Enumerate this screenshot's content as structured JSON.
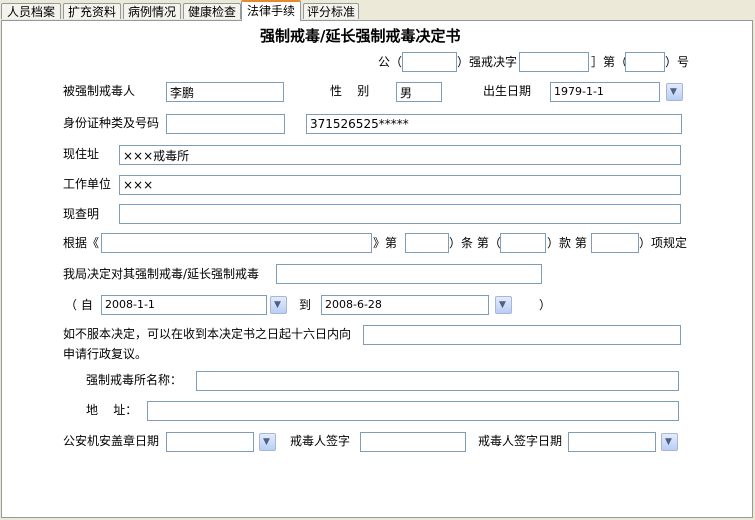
{
  "tabs": [
    {
      "label": "人员档案"
    },
    {
      "label": "扩充资料"
    },
    {
      "label": "病例情况"
    },
    {
      "label": "健康检查"
    },
    {
      "label": "法律手续"
    },
    {
      "label": "评分标准"
    }
  ],
  "form": {
    "title": "强制戒毒/延长强制戒毒决定书",
    "doc_no": {
      "prefix": "公（",
      "mid": "）强戒决字［",
      "mid2": "］第（",
      "suffix": "）号",
      "v1": "",
      "v2": "",
      "v3": ""
    },
    "person": {
      "label": "被强制戒毒人",
      "value": "李鹏"
    },
    "gender": {
      "label": "性    别",
      "value": "男"
    },
    "birth": {
      "label": "出生日期",
      "value": "1979-1-1"
    },
    "id_card": {
      "label": "身份证种类及号码",
      "type_value": "",
      "number_value": "371526525*****"
    },
    "address": {
      "label": "现住址",
      "value": "×××戒毒所"
    },
    "workplace": {
      "label": "工作单位",
      "value": "×××"
    },
    "investigation": {
      "label": "现查明",
      "value": ""
    },
    "basis": {
      "prefix": "根据《",
      "p2": "》第（",
      "p3": "）条 第（",
      "p4": "）款 第（",
      "p5": "）项规定",
      "v1": "",
      "v2": "",
      "v3": "",
      "v4": ""
    },
    "decision": {
      "label": "我局决定对其强制戒毒/延长强制戒毒",
      "value": ""
    },
    "period": {
      "open": "（ 自",
      "from": "2008-1-1",
      "to_label": "到",
      "to": "2008-6-28",
      "close": "）"
    },
    "appeal": {
      "line1": "如不服本决定，可以在收到本决定书之日起十六日内向",
      "line2": "申请行政复议。",
      "value": ""
    },
    "center_name": {
      "label": "强制戒毒所名称：",
      "value": ""
    },
    "center_addr": {
      "label": "地    址：",
      "value": ""
    },
    "stamp_date": {
      "label": "公安机安盖章日期",
      "value": ""
    },
    "sign": {
      "label": "戒毒人签字",
      "value": ""
    },
    "sign_date": {
      "label": "戒毒人签字日期",
      "value": ""
    }
  }
}
